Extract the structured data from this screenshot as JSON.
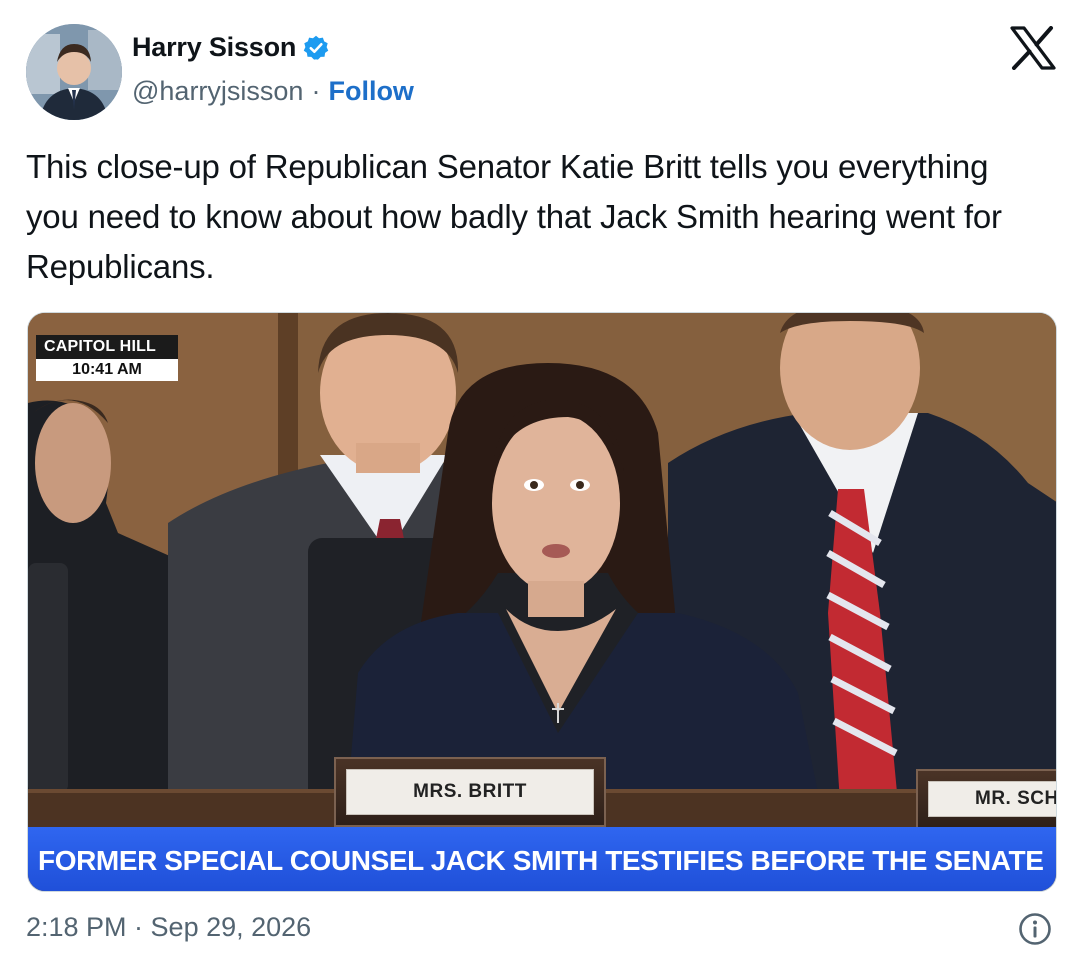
{
  "author": {
    "name": "Harry Sisson",
    "handle": "@harryjsisson",
    "separator": "·",
    "follow_label": "Follow",
    "verified_icon": "verified-badge-icon",
    "verified_color": "#1d9bf0"
  },
  "header": {
    "platform_icon": "x-logo-icon"
  },
  "tweet": {
    "text": "This close-up of Republican Senator Katie Britt tells you everything you need to know about how badly that Jack Smith hearing went for Republicans."
  },
  "media": {
    "bug_location": "CAPITOL HILL",
    "bug_time": "10:41 AM",
    "placard_center": "MRS. BRITT",
    "placard_right": "MR. SCH",
    "lower_third": "FORMER SPECIAL COUNSEL JACK SMITH TESTIFIES BEFORE THE SENATE",
    "lower_third_color": "#2a5ce6"
  },
  "footer": {
    "timestamp": "2:18 PM · Sep 29, 2026",
    "info_icon": "info-icon"
  },
  "colors": {
    "text_primary": "#0f1419",
    "text_secondary": "#536471",
    "link": "#1d6fc9"
  }
}
